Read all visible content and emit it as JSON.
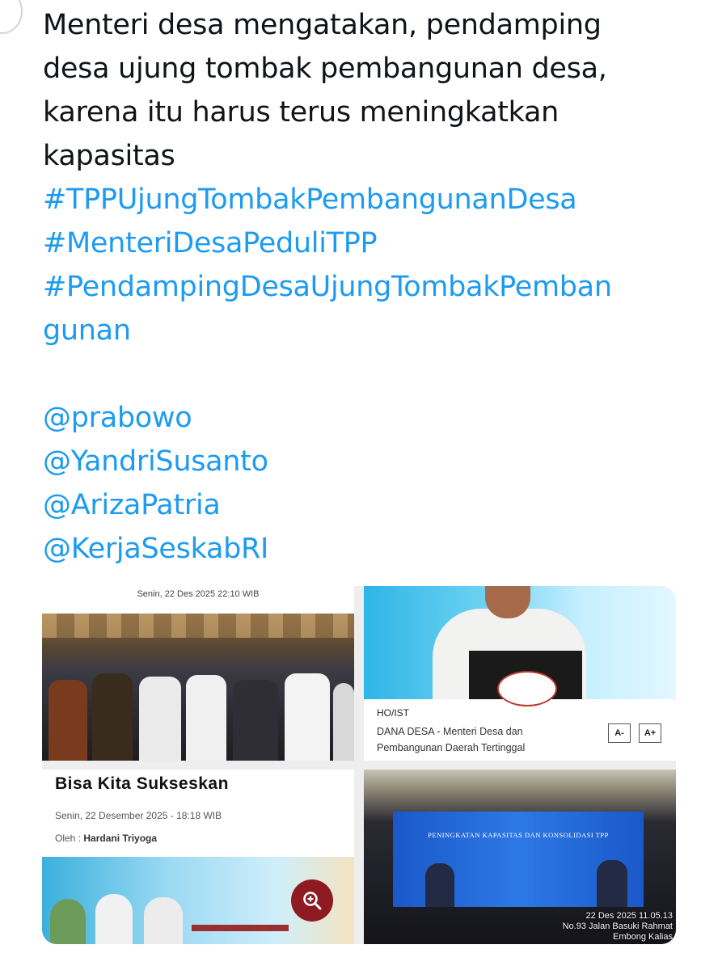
{
  "tweet": {
    "lines": [
      "Menteri desa mengatakan, pendamping",
      "desa  ujung tombak pembangunan desa,",
      "karena itu harus terus meningkatkan",
      "kapasitas"
    ],
    "hashtags": [
      "#TPPUjungTombakPembangunanDesa",
      "#MenteriDesaPeduliTPP",
      "#PendampingDesaUjungTombakPemban",
      "gunan"
    ],
    "mentions": [
      "@prabowo",
      "@YandriSusanto",
      "@ArizaPatria",
      "@KerjaSeskabRI"
    ]
  },
  "media": {
    "photo1": {
      "dateline": "Senin, 22 Des 2025 22:10 WIB"
    },
    "photo2": {
      "source": "HO/IST",
      "caption_line1": "DANA DESA - Menteri Desa dan",
      "caption_line2": "Pembangunan Daerah Tertinggal",
      "font_decrease": "A-",
      "font_increase": "A+"
    },
    "photo3": {
      "headline": "Bisa Kita Sukseskan",
      "date": "Senin, 22 Desember 2025 - 18:18 WIB",
      "author_label": "Oleh :",
      "author_name": "Hardani Triyoga"
    },
    "photo4": {
      "screen_title": "PENINGKATAN KAPASITAS DAN KONSOLIDASI TPP",
      "stamp_line1": "22 Des 2025 11.05.13",
      "stamp_line2": "No.93 Jalan Basuki Rahmat",
      "stamp_line3": "Embong Kalias"
    }
  },
  "colors": {
    "text": "#0f1419",
    "link": "#1d9bf0",
    "zoom_button": "#8e1a22"
  },
  "icons": {
    "zoom": "zoom-in-icon"
  }
}
